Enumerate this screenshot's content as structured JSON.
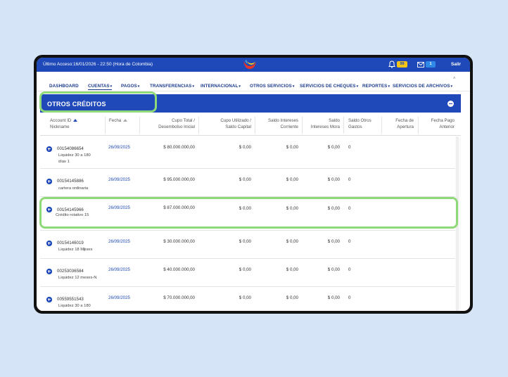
{
  "topbar": {
    "last_access": "Último Acceso:16/01/2026 - 22:50 (Hora de Colombia)",
    "notif_count": "99",
    "mail_count": "1",
    "logout": "Salir",
    "color": "#1f49b8"
  },
  "nav": {
    "items": [
      "DASHBOARD",
      "CUENTAS",
      "PAGOS",
      "TRANSFERENCIAS",
      "INTERNACIONAL",
      "OTROS SERVICIOS",
      "SERVICIOS DE CHEQUES",
      "REPORTES",
      "SERVICIOS DE ARCHIVOS"
    ]
  },
  "section": {
    "title": "OTROS CRÉDITOS"
  },
  "table": {
    "headers": {
      "account_id": "Account ID",
      "nickname": "Nickname",
      "fecha": "Fecha",
      "cupo_total_1": "Cupo Total /",
      "cupo_total_2": "Desembolso Inicial",
      "cupo_utilizado_1": "Cupo Utilizado /",
      "cupo_utilizado_2": "Saldo Capital",
      "saldo_int_corr_1": "Saldo Intereses",
      "saldo_int_corr_2": "Corriente",
      "saldo_int_mora_1": "Saldo",
      "saldo_int_mora_2": "Intereses Mora",
      "saldo_otros_1": "Saldo Otros",
      "saldo_otros_2": "Gastos",
      "fecha_apertura_1": "Fecha de",
      "fecha_apertura_2": "Apertura",
      "fecha_pago_1": "Fecha Pago",
      "fecha_pago_2": "Anterior"
    },
    "rows": [
      {
        "id": "00154086654",
        "nick": "Liquidez 30 a 180 días 1",
        "fecha": "26/09/2025",
        "cupo": "$ 80.000.000,00",
        "utilizado": "$ 0,00",
        "corriente": "$ 0,00",
        "mora": "$ 0,00",
        "otros": "0"
      },
      {
        "id": "00154145886",
        "nick": "cartera ordinaria",
        "fecha": "26/09/2025",
        "cupo": "$ 95.000.000,00",
        "utilizado": "$ 0,00",
        "corriente": "$ 0,00",
        "mora": "$ 0,00",
        "otros": "0"
      },
      {
        "id": "00154145966",
        "nick": "Crédito rotativo 15",
        "fecha": "26/09/2025",
        "cupo": "$ 87.000.000,00",
        "utilizado": "$ 0,00",
        "corriente": "$ 0,00",
        "mora": "$ 0,00",
        "otros": "0"
      },
      {
        "id": "00154146019",
        "nick": "Liquidez 18 Meses",
        "fecha": "26/09/2025",
        "cupo": "$ 30.000.000,00",
        "utilizado": "$ 0,00",
        "corriente": "$ 0,00",
        "mora": "$ 0,00",
        "otros": "0"
      },
      {
        "id": "00253036584",
        "nick": "Liquidez 12 meses-N",
        "fecha": "26/09/2025",
        "cupo": "$ 40.000.000,00",
        "utilizado": "$ 0,00",
        "corriente": "$ 0,00",
        "mora": "$ 0,00",
        "otros": "0"
      },
      {
        "id": "00559551543",
        "nick": "Liquidez 30 a 180",
        "fecha": "26/09/2025",
        "cupo": "$ 70.000.000,00",
        "utilizado": "$ 0,00",
        "corriente": "$ 0,00",
        "mora": "$ 0,00",
        "otros": "0"
      }
    ]
  }
}
